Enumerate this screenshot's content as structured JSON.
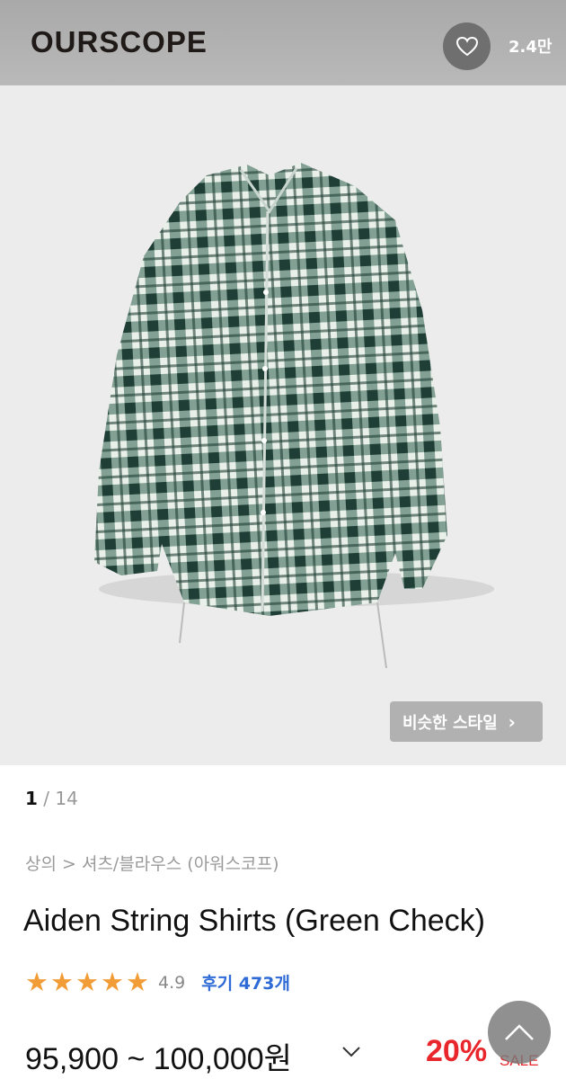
{
  "header": {
    "brand": "OURSCOPE",
    "like_count": "2.4만",
    "heart_icon": "heart-outline-icon"
  },
  "hero": {
    "similar_style_label": "비슷한 스타일",
    "similar_style_icon": "chevron-right-icon",
    "image_colors": {
      "check_green": "#2f5e4f",
      "check_light": "#e9efe9",
      "background": "#ececec"
    }
  },
  "pager": {
    "current": "1",
    "separator": "/",
    "total": "14"
  },
  "breadcrumb": "상의 > 셔츠/블라우스 (아워스코프)",
  "product": {
    "title": "Aiden String Shirts (Green Check)",
    "rating_stars": 5,
    "rating_score": "4.9",
    "reviews_label": "후기 473개",
    "price_range": "95,900 ~ 100,000원",
    "discount": "20%",
    "sale_label": "SALE"
  },
  "colors": {
    "accent_red": "#e8262b",
    "review_blue": "#2f6bd6",
    "star_orange": "#f29c38"
  },
  "icons": {
    "price_toggle": "chevron-down-icon",
    "scroll_top": "chevron-up-icon",
    "star": "star-icon"
  }
}
